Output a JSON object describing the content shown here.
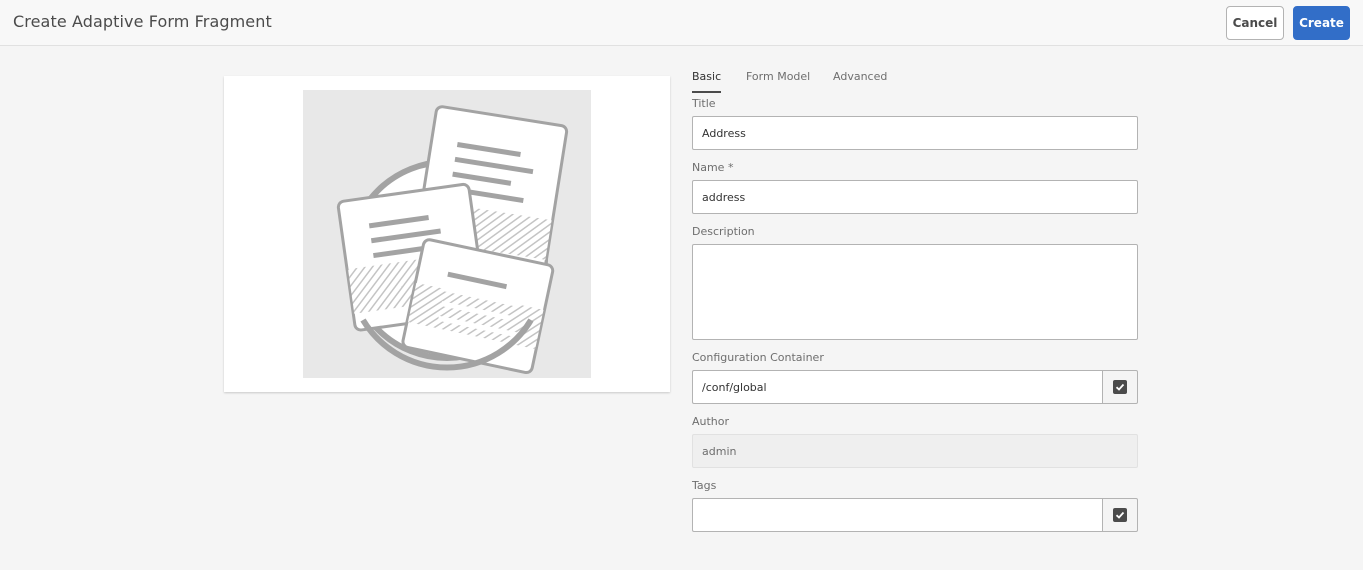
{
  "header": {
    "title": "Create Adaptive Form Fragment",
    "cancel_label": "Cancel",
    "create_label": "Create"
  },
  "tabs": [
    {
      "label": "Basic",
      "active": true
    },
    {
      "label": "Form Model",
      "active": false
    },
    {
      "label": "Advanced",
      "active": false
    }
  ],
  "form": {
    "title": {
      "label": "Title",
      "value": "Address"
    },
    "name": {
      "label": "Name *",
      "value": "address"
    },
    "description": {
      "label": "Description",
      "value": ""
    },
    "configuration_container": {
      "label": "Configuration Container",
      "value": "/conf/global",
      "picker_icon": "check-square-icon"
    },
    "author": {
      "label": "Author",
      "value": "admin"
    },
    "tags": {
      "label": "Tags",
      "value": "",
      "picker_icon": "check-square-icon"
    }
  },
  "thumbnail": {
    "icon": "form-fragment-documents-icon"
  },
  "colors": {
    "primary": "#326ec8",
    "background": "#f5f5f5"
  }
}
